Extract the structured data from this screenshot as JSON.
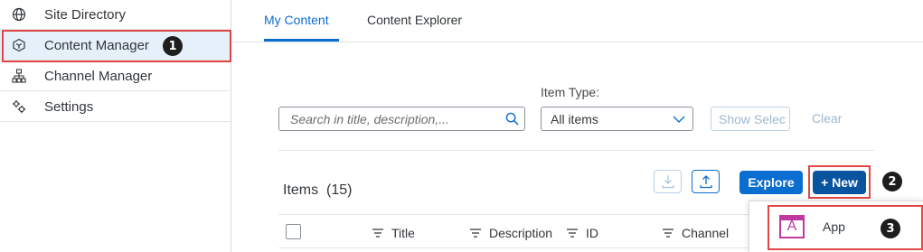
{
  "sidebar": {
    "items": [
      {
        "label": "Site Directory",
        "icon": "globe-icon"
      },
      {
        "label": "Content Manager",
        "icon": "cube-icon",
        "selected": true
      },
      {
        "label": "Channel Manager",
        "icon": "org-chart-icon"
      },
      {
        "label": "Settings",
        "icon": "gears-icon"
      }
    ]
  },
  "tabs": [
    {
      "label": "My Content",
      "active": true
    },
    {
      "label": "Content Explorer",
      "active": false
    }
  ],
  "filters": {
    "search_placeholder": "Search in title, description,...",
    "item_type_label": "Item Type:",
    "item_type_value": "All items",
    "show_selected_label": "Show Selec",
    "clear_label": "Clear"
  },
  "toolbar": {
    "items_title": "Items  (15)",
    "explore_label": "Explore",
    "new_label": "+ New"
  },
  "table": {
    "columns": [
      "Title",
      "Description",
      "ID",
      "Channel"
    ]
  },
  "new_menu": {
    "items": [
      {
        "label": "App",
        "icon": "app-tile-icon"
      }
    ]
  },
  "annotations": {
    "step1": "1",
    "step2": "2",
    "step3": "3"
  },
  "colors": {
    "accent": "#0a6ed1",
    "highlight": "#e04848",
    "app_tile": "#c0399f"
  }
}
